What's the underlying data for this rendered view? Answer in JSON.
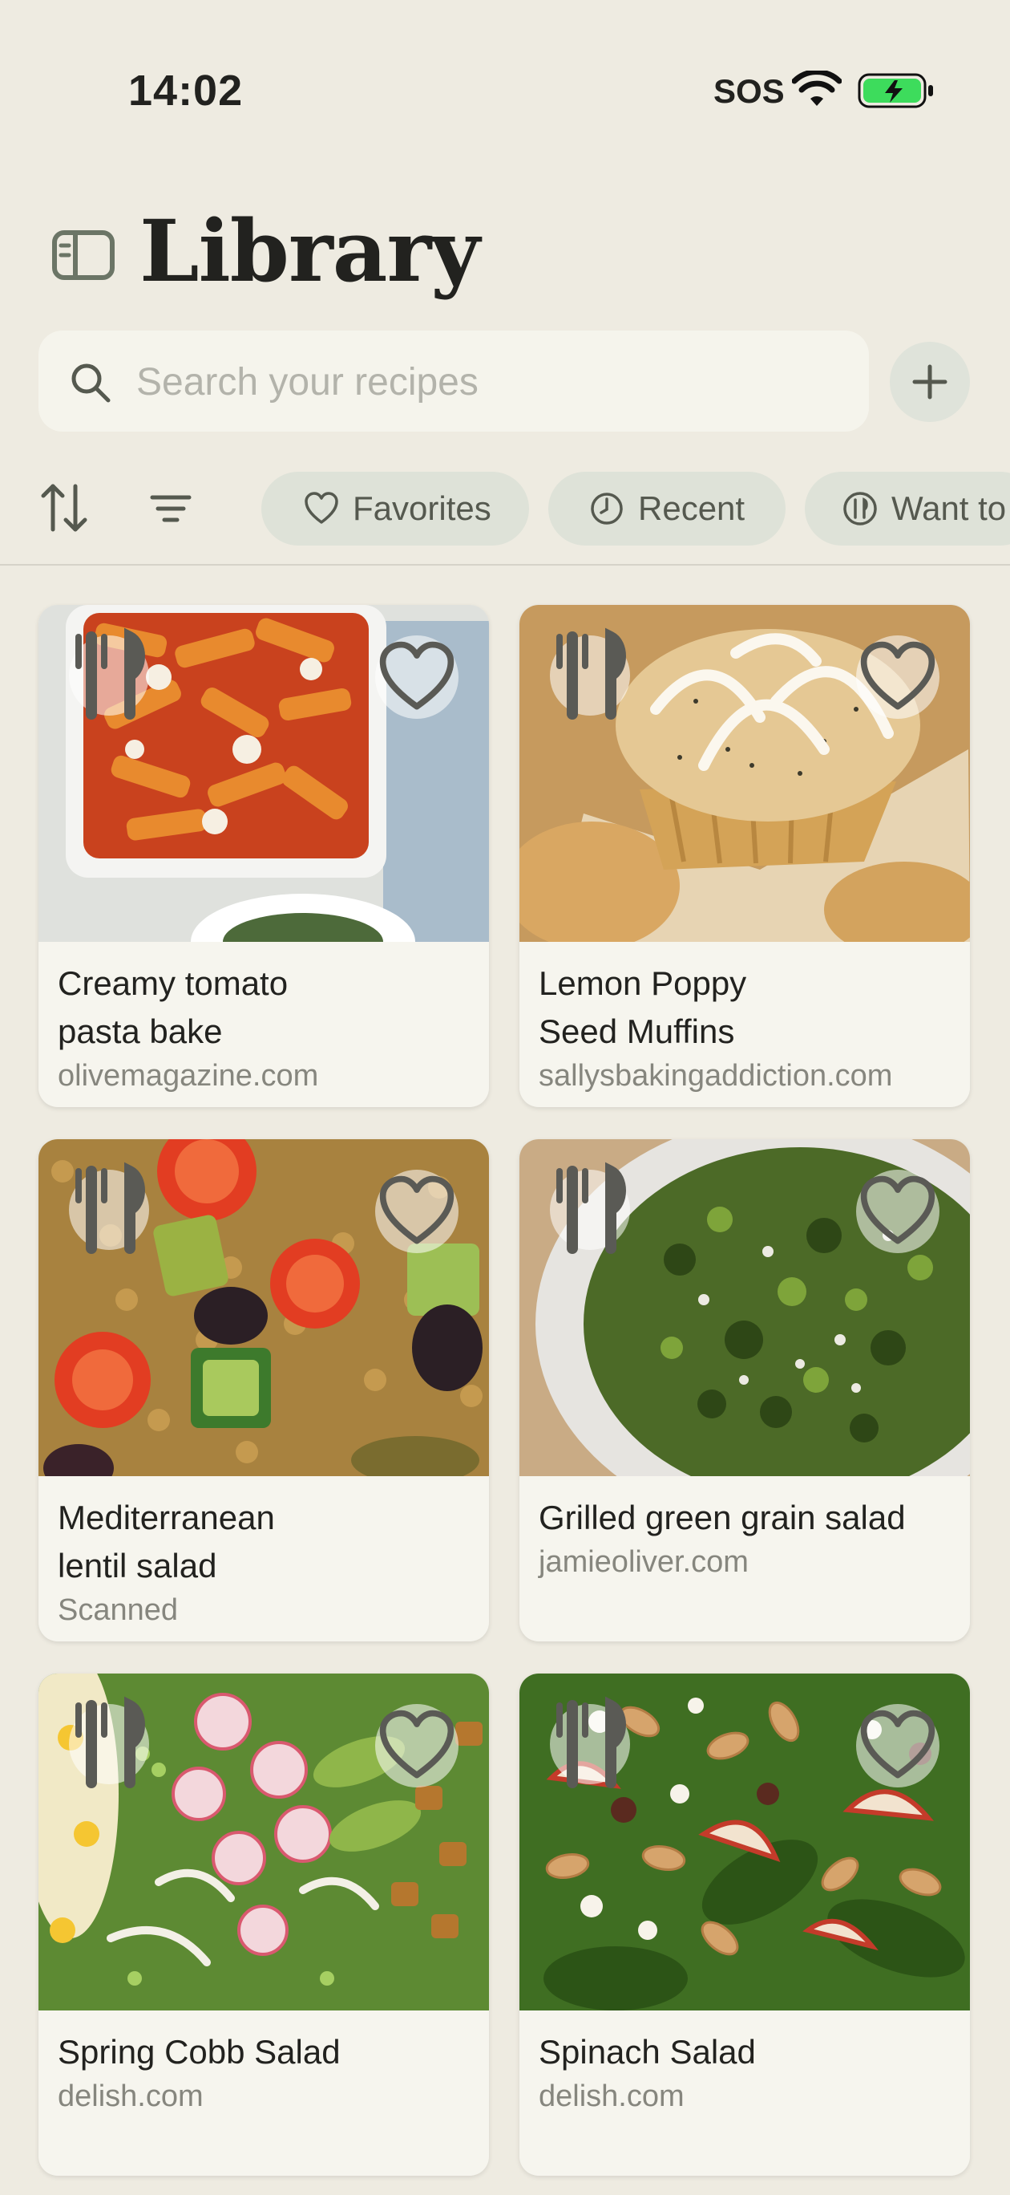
{
  "status_bar": {
    "time": "14:02",
    "carrier": "SOS"
  },
  "header": {
    "title": "Library"
  },
  "search": {
    "placeholder": "Search your recipes"
  },
  "filters": {
    "chips": [
      {
        "label": "Favorites",
        "icon": "heart-icon"
      },
      {
        "label": "Recent",
        "icon": "clock-icon"
      },
      {
        "label": "Want to",
        "icon": "utensils-icon"
      }
    ]
  },
  "recipes": [
    {
      "title": "Creamy tomato pasta bake",
      "source": "olivemagazine.com"
    },
    {
      "title": "Lemon Poppy Seed Muffins",
      "source": "sallysbakingaddiction.com"
    },
    {
      "title": "Mediterranean lentil salad",
      "source": "Scanned"
    },
    {
      "title": "Grilled green grain salad",
      "source": "jamieoliver.com"
    },
    {
      "title": "Spring Cobb Salad",
      "source": "delish.com"
    },
    {
      "title": "Spinach Salad",
      "source": "delish.com"
    }
  ],
  "colors": {
    "background": "#EEEBE1",
    "chip": "#DEE2D8",
    "card": "#F6F5EE",
    "battery": "#3DDC5C"
  }
}
